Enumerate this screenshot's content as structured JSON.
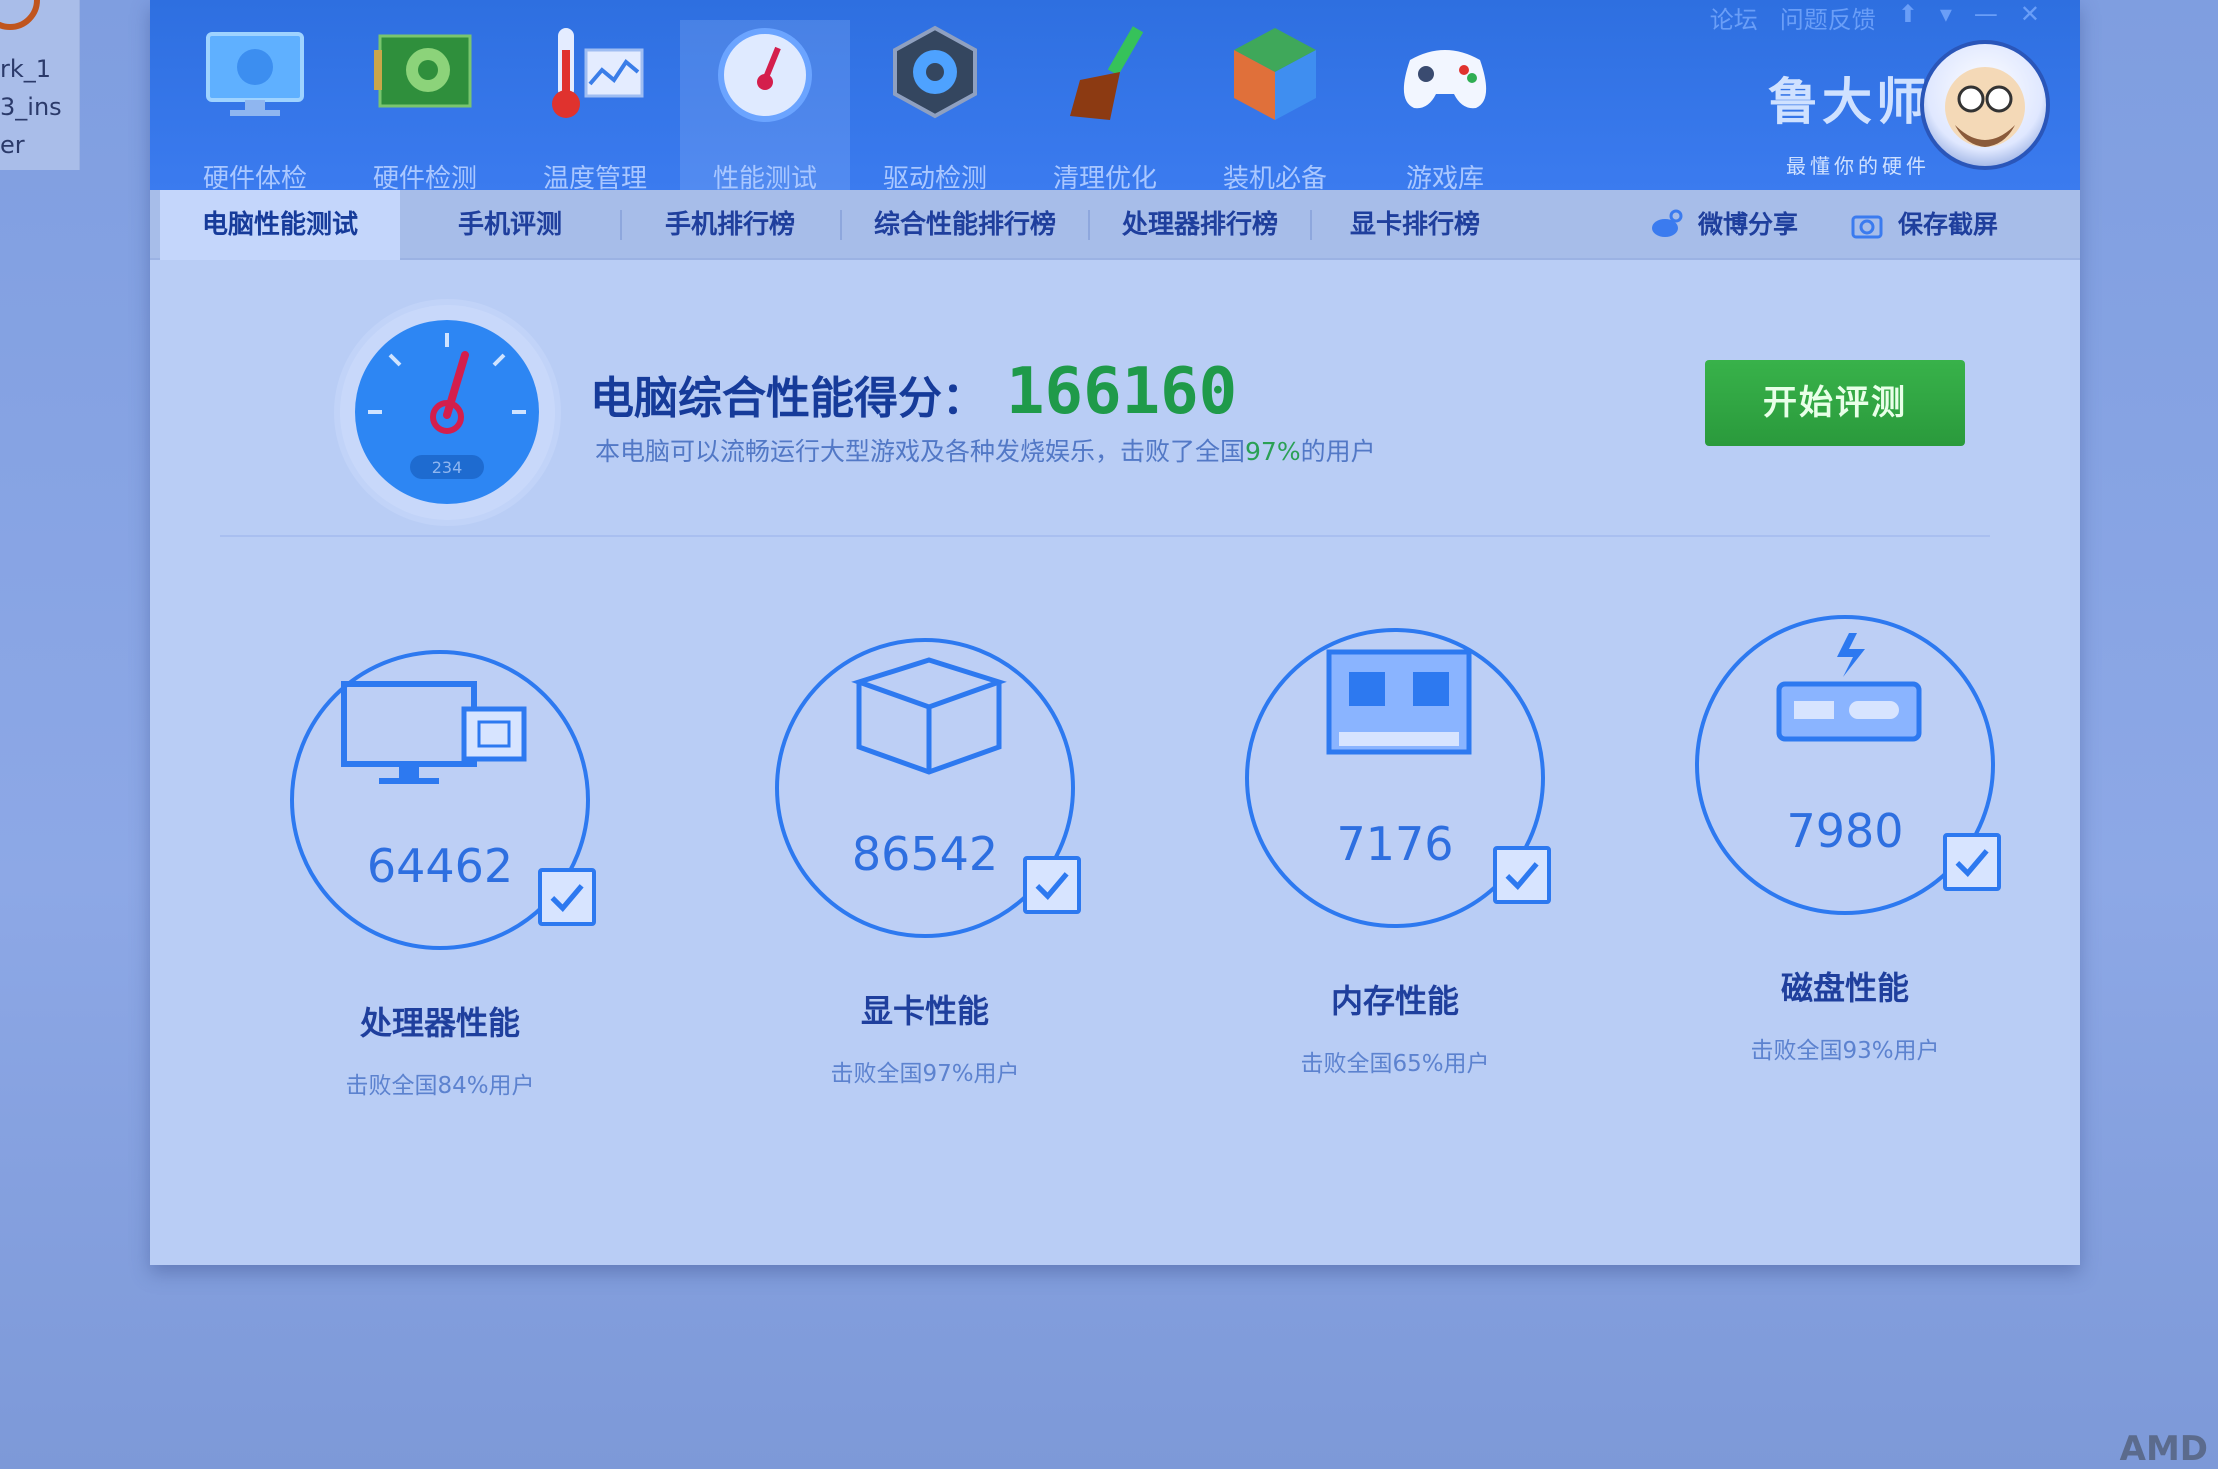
{
  "desktop": {
    "icon_label": "rk_1\n3_ins\ner"
  },
  "titlebar": {
    "tools": [
      {
        "label": "硬件体检",
        "icon": "monitor-icon"
      },
      {
        "label": "硬件检测",
        "icon": "circuit-board-icon"
      },
      {
        "label": "温度管理",
        "icon": "thermometer-icon"
      },
      {
        "label": "性能测试",
        "icon": "speedometer-icon",
        "active": true
      },
      {
        "label": "驱动检测",
        "icon": "gear-icon"
      },
      {
        "label": "清理优化",
        "icon": "broom-icon"
      },
      {
        "label": "装机必备",
        "icon": "cube-icon"
      },
      {
        "label": "游戏库",
        "icon": "gamepad-icon"
      }
    ],
    "controls": [
      "论坛",
      "问题反馈",
      "⬆",
      "▾",
      "—",
      "✕"
    ],
    "brand_name": "鲁大师",
    "brand_slogan": "最懂你的硬件"
  },
  "tabs": [
    {
      "label": "电脑性能测试",
      "active": true
    },
    {
      "label": "手机评测"
    },
    {
      "label": "手机排行榜"
    },
    {
      "label": "综合性能排行榜"
    },
    {
      "label": "处理器排行榜"
    },
    {
      "label": "显卡排行榜"
    }
  ],
  "tab_actions": {
    "weibo": "微博分享",
    "screenshot": "保存截屏"
  },
  "summary": {
    "title": "电脑综合性能得分：",
    "score": "166160",
    "desc_prefix": "本电脑可以流畅运行大型游戏及各种发烧娱乐，击败了全国",
    "desc_pct": "97%",
    "desc_suffix": "的用户",
    "gauge_badge": "234"
  },
  "start_button": "开始评测",
  "metrics": [
    {
      "value": "64462",
      "name": "处理器性能",
      "sub": "击败全国84%用户",
      "icon": "cpu-monitor-icon"
    },
    {
      "value": "86542",
      "name": "显卡性能",
      "sub": "击败全国97%用户",
      "icon": "gpu-cube-icon"
    },
    {
      "value": "7176",
      "name": "内存性能",
      "sub": "击败全国65%用户",
      "icon": "memory-chip-icon"
    },
    {
      "value": "7980",
      "name": "磁盘性能",
      "sub": "击败全国93%用户",
      "icon": "disk-drive-icon"
    }
  ],
  "watermark": "AMD",
  "colors": {
    "titlebar_blue": "#2e6fe0",
    "score_green": "#1f9a4a",
    "button_green": "#2a9a3c",
    "ring_blue": "#2d79f0"
  }
}
